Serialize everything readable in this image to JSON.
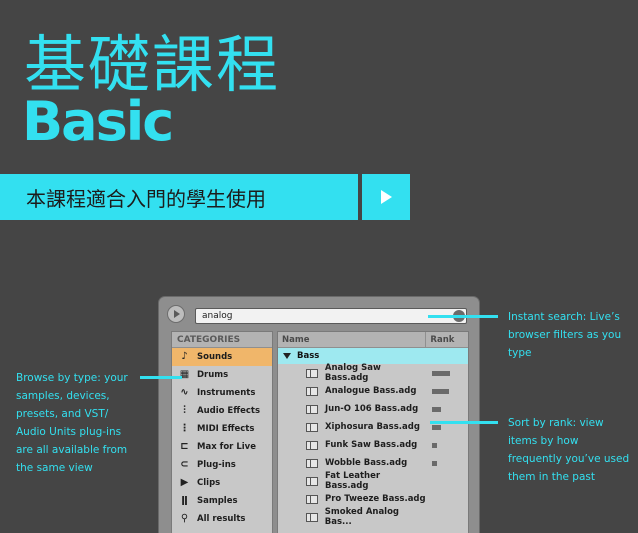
{
  "hero": {
    "title": "基礎課程",
    "subtitle": "Basic",
    "cta_label": "本課程適合入門的學生使用",
    "play_icon": "play-icon"
  },
  "colors": {
    "accent": "#33e0f0",
    "background": "#454545",
    "selected": "#f0b66a",
    "folder_highlight": "#9ee9f0"
  },
  "browser": {
    "search": {
      "value": "analog",
      "placeholder": ""
    },
    "sidebar": {
      "header": "CATEGORIES",
      "items": [
        {
          "label": "Sounds",
          "icon": "note-icon",
          "selected": true
        },
        {
          "label": "Drums",
          "icon": "grid-icon",
          "selected": false
        },
        {
          "label": "Instruments",
          "icon": "wave-icon",
          "selected": false
        },
        {
          "label": "Audio Effects",
          "icon": "audio-fx-icon",
          "selected": false
        },
        {
          "label": "MIDI Effects",
          "icon": "midi-fx-icon",
          "selected": false
        },
        {
          "label": "Max for Live",
          "icon": "max-icon",
          "selected": false
        },
        {
          "label": "Plug-ins",
          "icon": "plug-icon",
          "selected": false
        },
        {
          "label": "Clips",
          "icon": "clip-icon",
          "selected": false
        },
        {
          "label": "Samples",
          "icon": "sample-icon",
          "selected": false
        },
        {
          "label": "All results",
          "icon": "search-icon",
          "selected": false
        }
      ]
    },
    "filelist": {
      "columns": {
        "name": "Name",
        "rank": "Rank"
      },
      "folder": "Bass",
      "files": [
        {
          "name": "Analog Saw Bass.adg",
          "rank": 1.0
        },
        {
          "name": "Analogue Bass.adg",
          "rank": 0.95
        },
        {
          "name": "Jun-O 106 Bass.adg",
          "rank": 0.5
        },
        {
          "name": "Xiphosura Bass.adg",
          "rank": 0.5
        },
        {
          "name": "Funk Saw Bass.adg",
          "rank": 0.25
        },
        {
          "name": "Wobble Bass.adg",
          "rank": 0.25
        },
        {
          "name": "Fat Leather Bass.adg",
          "rank": 0
        },
        {
          "name": "Pro Tweeze Bass.adg",
          "rank": 0
        },
        {
          "name": "Smoked Analog Bas...",
          "rank": 0
        }
      ]
    }
  },
  "annotations": {
    "search": "Instant search: Live’s browser filters as you type",
    "browse": "Browse by type: your samples, devices, presets, and VST/ Audio Units plug-ins are all available from the same view",
    "rank": "Sort by rank: view items by how frequently you’ve used them in the past"
  }
}
